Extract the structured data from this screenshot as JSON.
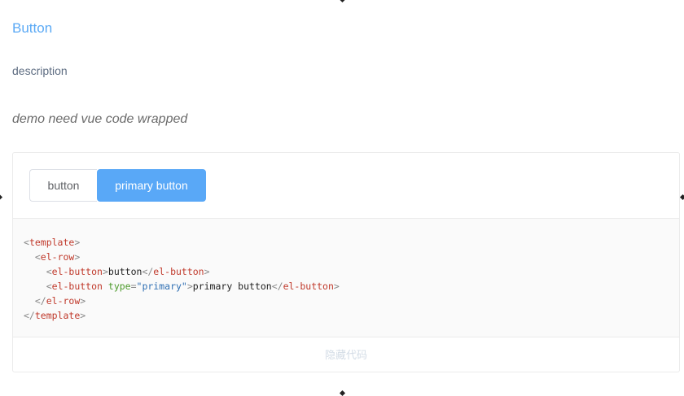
{
  "header": {
    "title": "Button",
    "description": "description",
    "note": "demo need vue code wrapped"
  },
  "demo": {
    "buttons": {
      "default_label": "button",
      "primary_label": "primary button"
    },
    "code": {
      "template_tag": "template",
      "row_tag": "el-row",
      "button_tag": "el-button",
      "attr_name": "type",
      "attr_value": "\"primary\"",
      "line_button_text": "button",
      "line_primary_text": "primary button"
    },
    "toggle_label": "隐藏代码"
  },
  "colors": {
    "accent": "#59a8f7",
    "title": "#5aa9f5"
  }
}
